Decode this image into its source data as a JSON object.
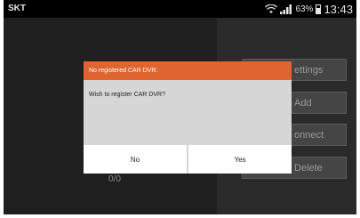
{
  "status_bar": {
    "carrier": "SKT",
    "battery_percent": "63%",
    "time": "13:43"
  },
  "side_buttons": [
    {
      "label": "ettings"
    },
    {
      "label": "Add"
    },
    {
      "label": "onnect"
    },
    {
      "label": "Delete"
    }
  ],
  "counter": "0/0",
  "dialog": {
    "title": "No registered CAR DVR.",
    "message": "Wish to register CAR DVR?",
    "no_label": "No",
    "yes_label": "Yes"
  },
  "colors": {
    "dialog_title_bg": "#e0642f",
    "dialog_body_bg": "#d6d6d6"
  }
}
